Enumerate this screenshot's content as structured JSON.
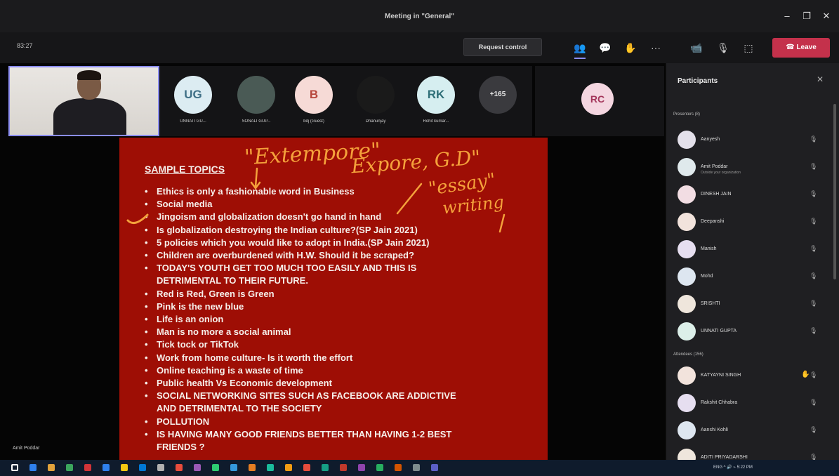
{
  "window": {
    "title": "Meeting in \"General\"",
    "minimize": "–",
    "restore": "❐",
    "close": "✕"
  },
  "toolbar": {
    "timer": "83:27",
    "request_control": "Request control",
    "leave": "Leave",
    "leave_icon": "☎",
    "icons": {
      "participants": "👥",
      "chat": "💬",
      "reactions": "✋",
      "more": "···",
      "camera": "📹",
      "mic": "🎙",
      "share": "⬚"
    }
  },
  "participants_strip": [
    {
      "initials": "UG",
      "name": "UNNATI GU...",
      "bg": "#dcecf2",
      "fg": "#3f6f86"
    },
    {
      "initials": "",
      "name": "SONALI GUP...",
      "bg": "#4a5a55",
      "fg": "#fff"
    },
    {
      "initials": "B",
      "name": "bdj (Guest)",
      "bg": "#f6dad6",
      "fg": "#b7473c"
    },
    {
      "initials": "",
      "name": "Dhanunjay",
      "bg": "#1a1a1a",
      "fg": "#fff"
    },
    {
      "initials": "RK",
      "name": "Rohit kumar...",
      "bg": "#d6eef0",
      "fg": "#2f6f78"
    },
    {
      "initials": "+165",
      "name": "",
      "bg": "#3a3a3e",
      "fg": "#e8e8e8"
    }
  ],
  "rc_tile": {
    "initials": "RC",
    "bg": "#f4d6e0",
    "fg": "#a3355a"
  },
  "slide": {
    "heading": "SAMPLE TOPICS",
    "topics": [
      "Ethics is only a fashionable word in Business",
      "Social media",
      "Jingoism and globalization doesn't go hand in hand",
      "Is globalization destroying the Indian culture?(SP Jain 2021)",
      "5 policies which you would like to adopt in India.(SP Jain 2021)",
      "Children are overburdened with H.W. Should it be scraped?",
      "TODAY'S YOUTH GET TOO MUCH TOO EASILY AND THIS IS",
      "DETRIMENTAL TO THEIR FUTURE.",
      "Red is Red, Green is Green",
      "Pink is the new blue",
      "Life is an onion",
      "Man is no more a social animal",
      "Tick tock or TikTok",
      "Work from home culture- Is it worth the effort",
      "Online teaching is a waste of time",
      "Public health Vs Economic development",
      "SOCIAL NETWORKING SITES SUCH AS FACEBOOK ARE ADDICTIVE",
      "AND DETRIMENTAL TO THE SOCIETY",
      "POLLUTION",
      "IS HAVING MANY GOOD FRIENDS BETTER THAN HAVING 1-2 BEST",
      "FRIENDS ?"
    ],
    "annotations": {
      "extempore": "\"Extempore\"",
      "expert_gd": "Expore, G.D\"",
      "essay": "\"essay\"",
      "writing": "writing"
    }
  },
  "presenter_label": "Amit Poddar",
  "panel": {
    "title": "Participants",
    "close": "✕",
    "presenters_label": "Presenters (8)",
    "attendees_label": "Attendees (156)",
    "presenters": [
      {
        "name": "Aanyesh",
        "sub": ""
      },
      {
        "name": "Amit Poddar",
        "sub": "Outside your organization"
      },
      {
        "name": "DINESH JAIN",
        "sub": ""
      },
      {
        "name": "Deepanshi",
        "sub": ""
      },
      {
        "name": "Manish",
        "sub": ""
      },
      {
        "name": "Mohd",
        "sub": ""
      },
      {
        "name": "SRISHTI",
        "sub": ""
      },
      {
        "name": "UNNATI GUPTA",
        "sub": ""
      }
    ],
    "attendees": [
      {
        "name": "KATYAYNI SINGH",
        "hand": true
      },
      {
        "name": "Rakshit Chhabra",
        "hand": false
      },
      {
        "name": "Aanshi Kohli",
        "hand": false
      },
      {
        "name": "ADITI PRIYADARSHI",
        "hand": false
      }
    ]
  },
  "taskbar": {
    "tray": "ENG ^ 🔊 ⌁ 5:22 PM",
    "icon_colors": [
      "#ffffff",
      "#2f80ed",
      "#e1a23b",
      "#3ba55d",
      "#d13438",
      "#2f80ed",
      "#f2c811",
      "#0078d4",
      "#b0b0b0",
      "#e74c3c",
      "#9b59b6",
      "#2ecc71",
      "#3498db",
      "#e67e22",
      "#1abc9c",
      "#f39c12",
      "#e74c3c",
      "#16a085",
      "#c0392b",
      "#8e44ad",
      "#27ae60",
      "#d35400",
      "#7f8c8d",
      "#5b5fc7"
    ]
  }
}
